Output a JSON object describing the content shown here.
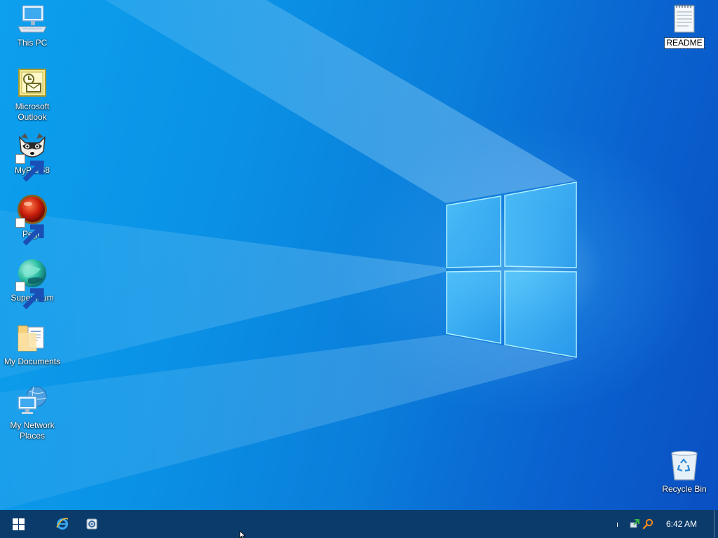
{
  "desktop": {
    "icons": [
      {
        "id": "this-pc",
        "label": "This PC",
        "icon": "computer-icon",
        "shortcut": false
      },
      {
        "id": "outlook",
        "label": "Microsoft Outlook",
        "icon": "outlook-icon",
        "shortcut": false
      },
      {
        "id": "mypal",
        "label": "MyPal 68",
        "icon": "raccoon-icon",
        "shortcut": true
      },
      {
        "id": "pego",
        "label": "Pego",
        "icon": "red-ball-icon",
        "shortcut": true
      },
      {
        "id": "supermium",
        "label": "Supermium",
        "icon": "supermium-icon",
        "shortcut": true
      },
      {
        "id": "my-documents",
        "label": "My Documents",
        "icon": "folder-documents-icon",
        "shortcut": false
      },
      {
        "id": "my-network-places",
        "label": "My Network Places",
        "icon": "network-icon",
        "shortcut": false
      },
      {
        "id": "readme",
        "label": "README",
        "icon": "notepad-icon",
        "shortcut": false,
        "selected": true
      },
      {
        "id": "recycle-bin",
        "label": "Recycle Bin",
        "icon": "recycle-bin-icon",
        "shortcut": false
      }
    ]
  },
  "taskbar": {
    "start_icon": "windows-logo-icon",
    "pinned": [
      {
        "id": "internet-explorer",
        "icon": "internet-explorer-icon"
      },
      {
        "id": "settings-app",
        "icon": "app-icon"
      }
    ],
    "tray": {
      "indicator": "ı",
      "icons": [
        "network-status-icon",
        "search-icon"
      ],
      "time": "6:42 AM"
    }
  },
  "colors": {
    "taskbar": "#0b3b6a",
    "wallpaper_light": "#0da0ee",
    "wallpaper_dark": "#0a4fc2"
  }
}
